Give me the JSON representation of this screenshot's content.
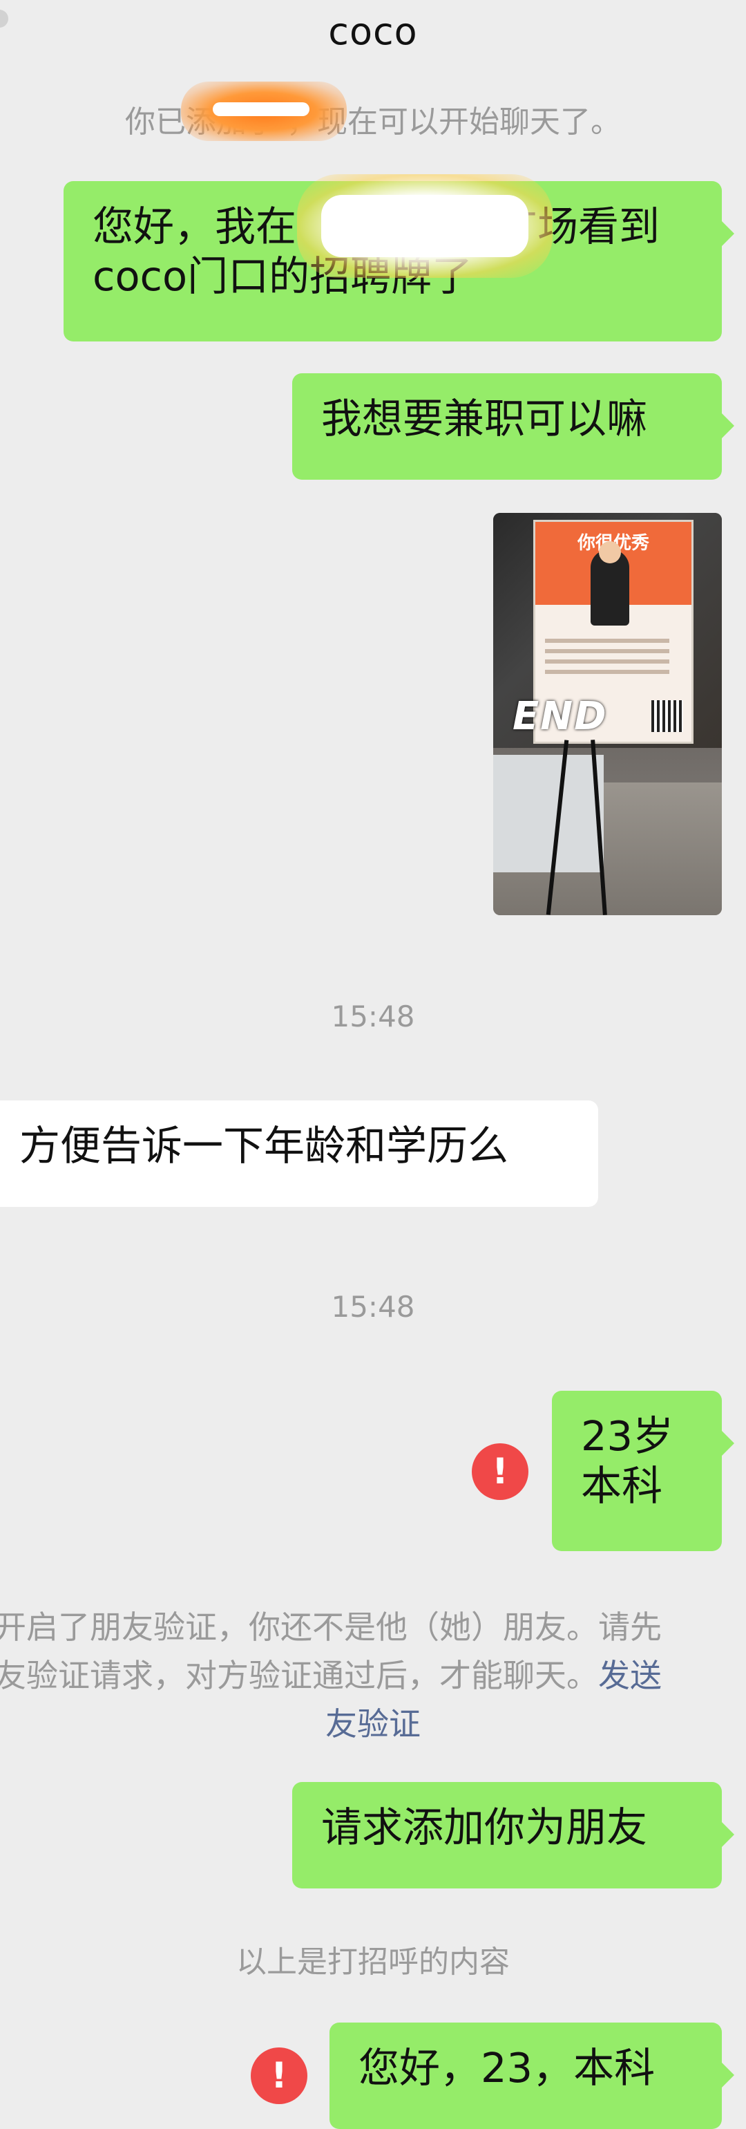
{
  "header": {
    "title": "coco"
  },
  "messages": {
    "system_added": "你已添加了  ，现在可以开始聊天了。",
    "m1_line1_a": "您好，我在",
    "m1_line1_b": "广场看到",
    "m1_line2": "coco门口的招聘牌了",
    "m2": "我想要兼职可以嘛",
    "photo_overlay": "END",
    "poster_title": "你很优秀",
    "time1": "15:48",
    "incoming1": "方便告诉一下年龄和学历么",
    "time2": "15:48",
    "m3_line1": "23岁",
    "m3_line2": "本科",
    "alert_glyph": "!",
    "verify_line1": "开启了朋友验证，你还不是他（她）朋友。请先",
    "verify_line2_a": "友验证请求，对方验证通过后，才能聊天。",
    "verify_line2_link": "发送",
    "verify_line3_link": "友验证",
    "m4": "请求添加你为朋友",
    "greeting_note": "以上是打招呼的内容",
    "m5_partial": "您好，23，本科"
  },
  "colors": {
    "bubble_outgoing": "#95ec69",
    "bubble_incoming": "#ffffff",
    "background": "#ededed",
    "link": "#576b95",
    "alert": "#f04848"
  },
  "icons": {
    "alert": "exclamation-circle-icon"
  }
}
